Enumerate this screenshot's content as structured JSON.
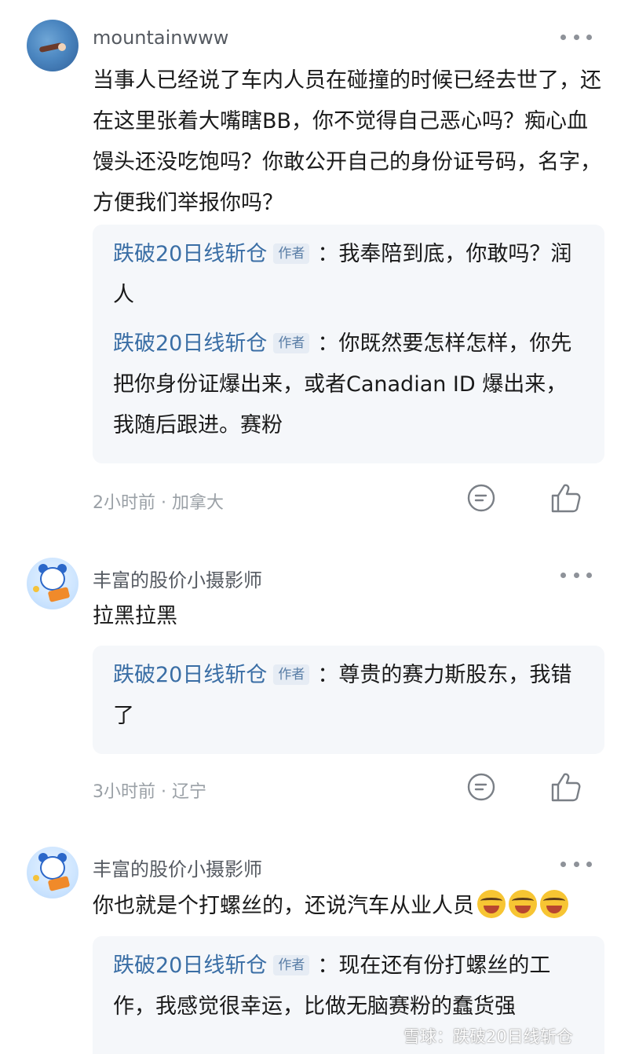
{
  "comments": [
    {
      "username": "mountainwww",
      "body": "当事人已经说了车内人员在碰撞的时候已经去世了，还在这里张着大嘴瞎BB，你不觉得自己恶心吗？痴心血馒头还没吃饱吗？你敢公开自己的身份证号码，名字，方便我们举报你吗？",
      "replies": [
        {
          "author": "跌破20日线斩仓",
          "tag": "作者",
          "text": "：我奉陪到底，你敢吗？润人"
        },
        {
          "author": "跌破20日线斩仓",
          "tag": "作者",
          "text": "：你既然要怎样怎样，你先把你身份证爆出来，或者Canadian ID 爆出来，我随后跟进。赛粉"
        }
      ],
      "meta": "2小时前 · 加拿大"
    },
    {
      "username": "丰富的股价小摄影师",
      "body": "拉黑拉黑",
      "replies": [
        {
          "author": "跌破20日线斩仓",
          "tag": "作者",
          "text": "：尊贵的赛力斯股东，我错了"
        }
      ],
      "meta": "3小时前 · 辽宁"
    },
    {
      "username": "丰富的股价小摄影师",
      "body": "你也就是个打螺丝的，还说汽车从业人员",
      "emoji_count": 3,
      "replies": [
        {
          "author": "跌破20日线斩仓",
          "tag": "作者",
          "text": "：现在还有份打螺丝的工作，我感觉很幸运，比做无脑赛粉的蠢货强"
        }
      ]
    }
  ],
  "icons": {
    "comment": "comment-bubble-icon",
    "like": "thumbs-up-icon",
    "more": "more-dots-icon"
  },
  "watermark": "雪球：跌破20日线斩仓",
  "colors": {
    "author_link": "#3a6ea5",
    "reply_bg": "#f5f7fa",
    "meta_text": "#9aa0a6"
  }
}
